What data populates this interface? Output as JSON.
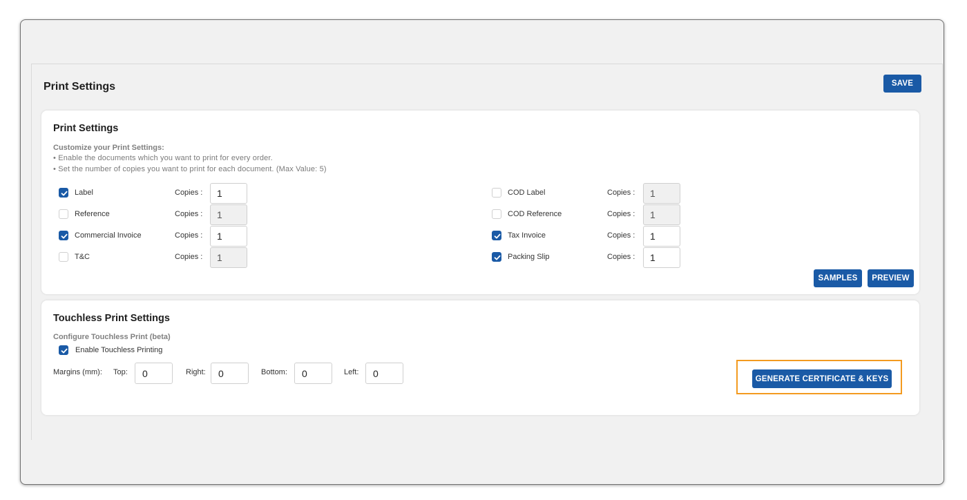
{
  "page": {
    "title": "Print Settings",
    "save_label": "SAVE"
  },
  "print_card": {
    "title": "Print Settings",
    "subhead": "Customize your Print Settings:",
    "bullets": [
      "• Enable the documents which you want to print for every order.",
      "• Set the number of copies you want to print for each document. (Max Value: 5)"
    ],
    "copies_label": "Copies :",
    "left_docs": [
      {
        "label": "Label",
        "checked": true,
        "copies": "1"
      },
      {
        "label": "Reference",
        "checked": false,
        "copies": "1"
      },
      {
        "label": "Commercial Invoice",
        "checked": true,
        "copies": "1"
      },
      {
        "label": "T&C",
        "checked": false,
        "copies": "1"
      }
    ],
    "right_docs": [
      {
        "label": "COD Label",
        "checked": false,
        "copies": "1"
      },
      {
        "label": "COD Reference",
        "checked": false,
        "copies": "1"
      },
      {
        "label": "Tax Invoice",
        "checked": true,
        "copies": "1"
      },
      {
        "label": "Packing Slip",
        "checked": true,
        "copies": "1"
      }
    ],
    "samples_label": "SAMPLES",
    "preview_label": "PREVIEW"
  },
  "touchless_card": {
    "title": "Touchless Print Settings",
    "subhead": "Configure Touchless Print (beta)",
    "enable_label": "Enable Touchless Printing",
    "enable_checked": true,
    "margins_label": "Margins (mm):",
    "top_label": "Top:",
    "top_value": "0",
    "right_label": "Right:",
    "right_value": "0",
    "bottom_label": "Bottom:",
    "bottom_value": "0",
    "left_label": "Left:",
    "left_value": "0",
    "generate_label": "GENERATE CERTIFICATE & KEYS"
  },
  "colors": {
    "accent": "#1a5aa6",
    "highlight": "#f39a1f"
  }
}
